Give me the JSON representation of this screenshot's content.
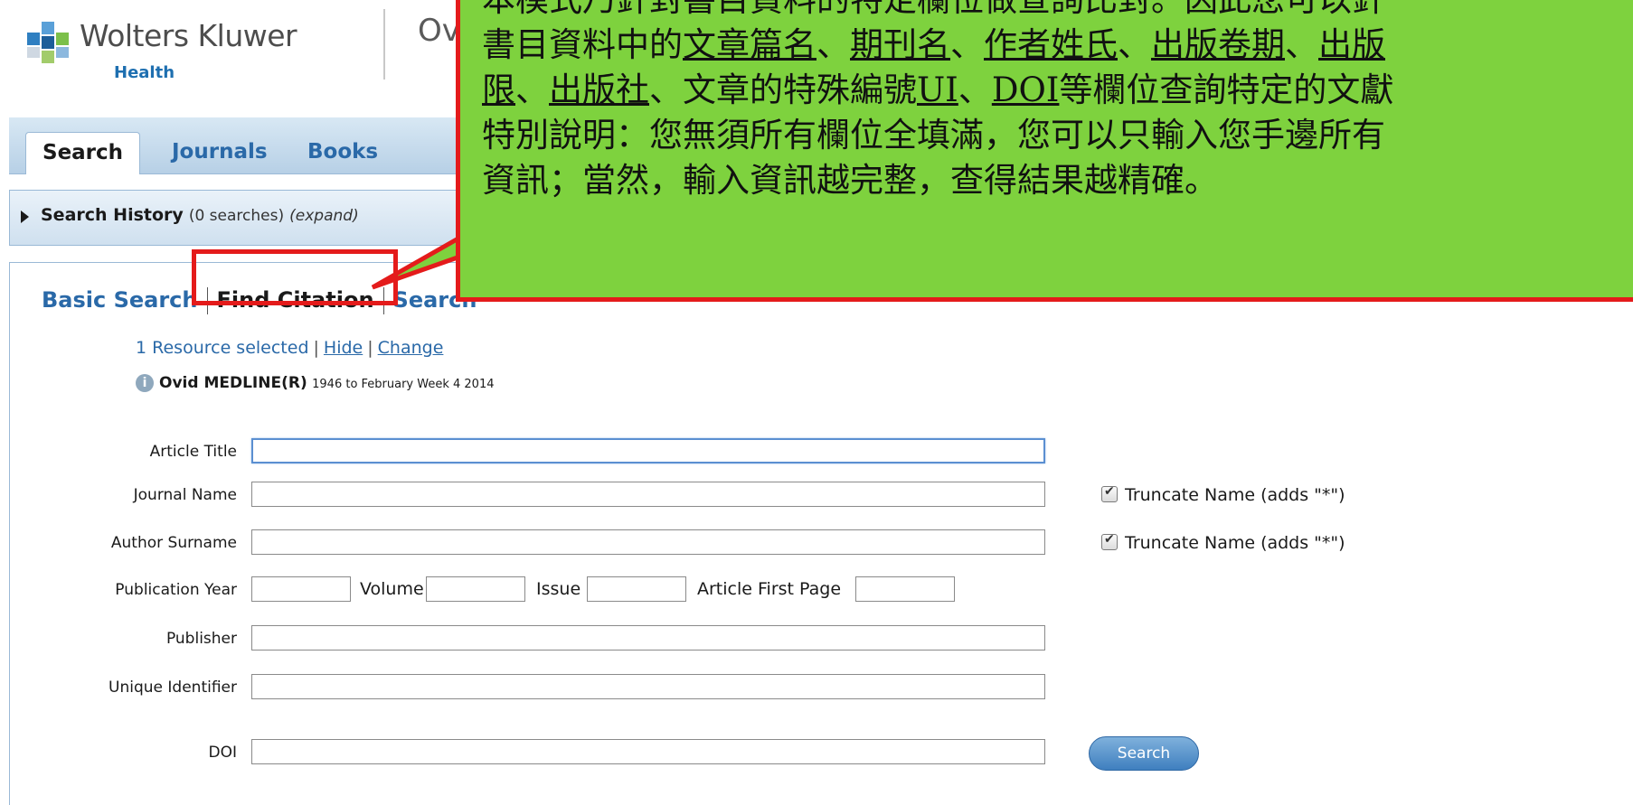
{
  "header": {
    "brand_name": "Wolters Kluwer",
    "brand_sub": "Health",
    "partial_title": "Ov"
  },
  "tabs": [
    {
      "label": "Search",
      "active": true
    },
    {
      "label": "Journals",
      "active": false
    },
    {
      "label": "Books",
      "active": false
    }
  ],
  "history": {
    "label": "Search History",
    "count": "(0 searches)",
    "expand": "(expand)"
  },
  "modes": {
    "basic": "Basic Search",
    "find_citation": "Find Citation",
    "search_tools_partial": "Search"
  },
  "resources": {
    "selected": "1 Resource selected",
    "hide": "Hide",
    "change": "Change",
    "db_name": "Ovid MEDLINE(R)",
    "db_range": "1946 to February Week 4 2014",
    "info_glyph": "i"
  },
  "form": {
    "article_title": {
      "label": "Article Title",
      "value": ""
    },
    "journal_name": {
      "label": "Journal Name",
      "value": ""
    },
    "author_surname": {
      "label": "Author Surname",
      "value": ""
    },
    "publication_year": {
      "label": "Publication Year",
      "value": ""
    },
    "volume": {
      "label": "Volume",
      "value": ""
    },
    "issue": {
      "label": "Issue",
      "value": ""
    },
    "article_first_page": {
      "label": "Article First Page",
      "value": ""
    },
    "publisher": {
      "label": "Publisher",
      "value": ""
    },
    "unique_identifier": {
      "label": "Unique Identifier",
      "value": ""
    },
    "doi": {
      "label": "DOI",
      "value": ""
    },
    "truncate_journal": {
      "label": "Truncate Name (adds \"*\")",
      "checked": true
    },
    "truncate_author": {
      "label": "Truncate Name (adds \"*\")",
      "checked": true
    },
    "search_button": "Search"
  },
  "callout": {
    "line1": "本模式乃針對書目資料的特定欄位做查詢比對。因此您可以針",
    "line2_a": "書目資料中的",
    "line2_u1": "文章篇名",
    "line2_s1": "、",
    "line2_u2": "期刊名",
    "line2_s2": "、",
    "line2_u3": "作者姓氏",
    "line2_s3": "、",
    "line2_u4": "出版卷期",
    "line2_s4": "、",
    "line2_u5": "出版",
    "line3_u1": "限",
    "line3_s1": "、",
    "line3_u2": "出版社",
    "line3_a": "、文章的特殊編號",
    "line3_u3": "UI",
    "line3_s2": "、",
    "line3_u4": "DOI",
    "line3_b": "等欄位查詢特定的文獻",
    "line4": "特別說明：您無須所有欄位全填滿，您可以只輸入您手邊所有",
    "line5": "資訊；當然，輸入資訊越完整，查得結果越精確。"
  },
  "colors": {
    "link_blue": "#2a69a8",
    "callout_green": "#7ed23e",
    "annotation_red": "#e41b1b",
    "brand_blue": "#1e6fb0"
  }
}
